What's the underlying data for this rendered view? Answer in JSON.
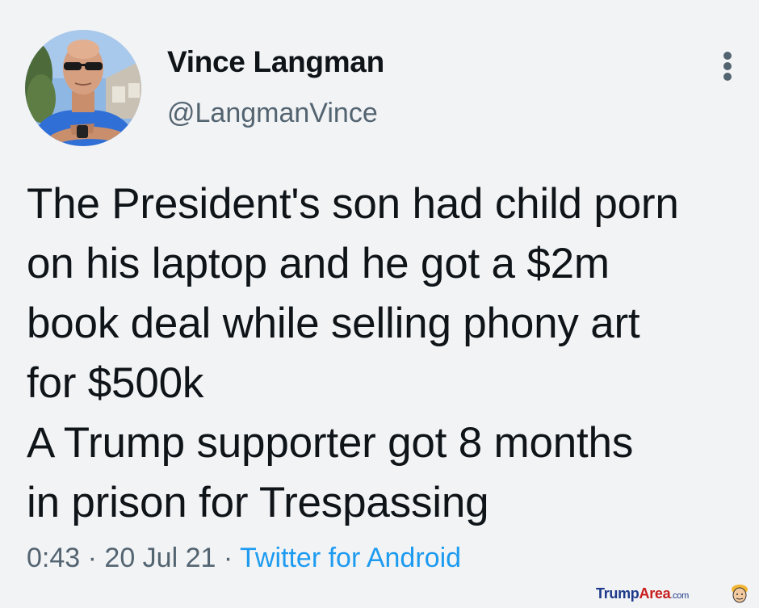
{
  "tweet": {
    "display_name": "Vince Langman",
    "handle": "@LangmanVince",
    "text_lines": [
      "The President's son had child porn",
      "on his laptop and he got a $2m",
      "book deal while selling phony art",
      "for $500k",
      "A Trump supporter got 8 months",
      "in prison for Trespassing"
    ],
    "time": "0:43",
    "separator": "·",
    "date": "20 Jul 21",
    "source": "Twitter for Android"
  },
  "watermark": {
    "part1": "Trump",
    "part2": "Area",
    "part3": ".com"
  },
  "colors": {
    "background": "#f2f3f5",
    "text_primary": "#0f1419",
    "text_secondary": "#536471",
    "link": "#1d9bf0"
  },
  "icons": {
    "more": "more-vertical-icon",
    "watermark_logo": "trump-caricature-icon"
  }
}
